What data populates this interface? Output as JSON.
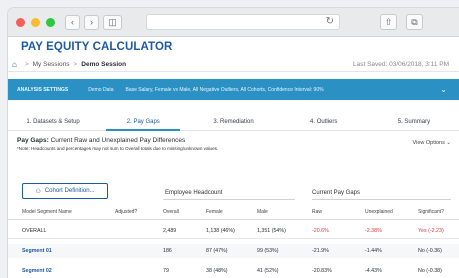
{
  "app": {
    "title": "PAY EQUITY CALCULATOR",
    "breadcrumb": [
      "My Sessions",
      "Demo Session"
    ],
    "last_saved": "Last Saved: 03/06/2018, 3:11 PM"
  },
  "banner": {
    "label": "ANALYSIS SETTINGS",
    "source": "Demo Data",
    "summary": "Base Salary, Female vs Male, All Negative Outliers, All Cohorts, Confidence Interval: 90%"
  },
  "steps": [
    "1. Datasets & Setup",
    "2. Pay Gaps",
    "3. Remediation",
    "4. Outliers",
    "5. Summary"
  ],
  "active_step": 1,
  "gaps": {
    "title_bold": "Pay Gaps:",
    "title_rest": "Current Raw and Unexplained Pay Differences",
    "note": "*Note: Headcounts and percentages may not sum to Overall totals due to missing/unknown values.",
    "view_options": "View Options"
  },
  "cohort_button": "Cohort Definition...",
  "groups": {
    "employee": "Employee Headcount",
    "pay": "Current Pay Gaps"
  },
  "columns": [
    "Model Segment Name",
    "Adjusted?",
    "Overall",
    "Female",
    "Male",
    "Raw",
    "Unexplained",
    "Significant?"
  ],
  "rows": [
    {
      "name": "OVERALL",
      "adjusted": "",
      "overall": "2,489",
      "female": "1,138 (46%)",
      "male": "1,351 (54%)",
      "raw": "-20.6%",
      "unexplained": "-2.38%",
      "significant": "Yes (-2.23)"
    },
    {
      "name": "Segment 01",
      "adjusted": "",
      "overall": "186",
      "female": "87 (47%)",
      "male": "99 (53%)",
      "raw": "-21.9%",
      "unexplained": "-1.44%",
      "significant": "No (-0.36)"
    },
    {
      "name": "Segment 02",
      "adjusted": "",
      "overall": "79",
      "female": "38 (48%)",
      "male": "41 (52%)",
      "raw": "-20.83%",
      "unexplained": "-4.43%",
      "significant": "No (-0.38)"
    }
  ],
  "colors": {
    "brand": "#1e5aa0",
    "banner": "#2b91c4",
    "negative": "#d93a3a"
  }
}
